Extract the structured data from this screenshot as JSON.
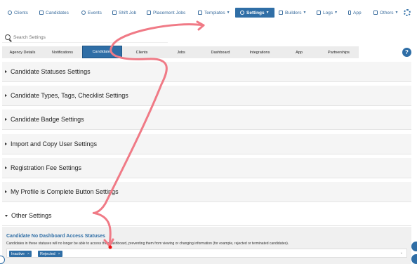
{
  "nav": {
    "clients": "Clients",
    "candidates": "Candidates",
    "events": "Events",
    "shift_job": "Shift Job",
    "placement_jobs": "Placement Jobs",
    "templates": "Templates",
    "settings": "Settings",
    "builders": "Builders",
    "logs": "Logs",
    "app": "App",
    "others": "Others"
  },
  "search": {
    "placeholder": "Search Settings"
  },
  "tabs": {
    "agency_details": "Agency Details",
    "notifications": "Notifications",
    "candidates": "Candidates",
    "clients": "Clients",
    "jobs": "Jobs",
    "dashboard": "Dashboard",
    "integrations": "Integrations",
    "app": "App",
    "partnerships": "Partnerships"
  },
  "help": "?",
  "sections": {
    "s1": "Candidate Statuses Settings",
    "s2": "Candidate Types, Tags, Checklist Settings",
    "s3": "Candidate Badge Settings",
    "s4": "Import and Copy User Settings",
    "s5": "Registration Fee Settings",
    "s6": "My Profile is Complete Button Settings",
    "s7": "Other Settings"
  },
  "panel": {
    "title": "Candidate No Dashboard Access Statuses",
    "description": "Candidates in these statuses will no longer be able to access their dashboard, preventing them from viewing or changing information (for example, rejected or terminated candidates).",
    "chips": {
      "c1": "Inactive",
      "c2": "Rejected"
    },
    "remove": "×",
    "caret": "⌄"
  },
  "colors": {
    "accent": "#2f6ea6",
    "annotation": "#f07a86"
  }
}
